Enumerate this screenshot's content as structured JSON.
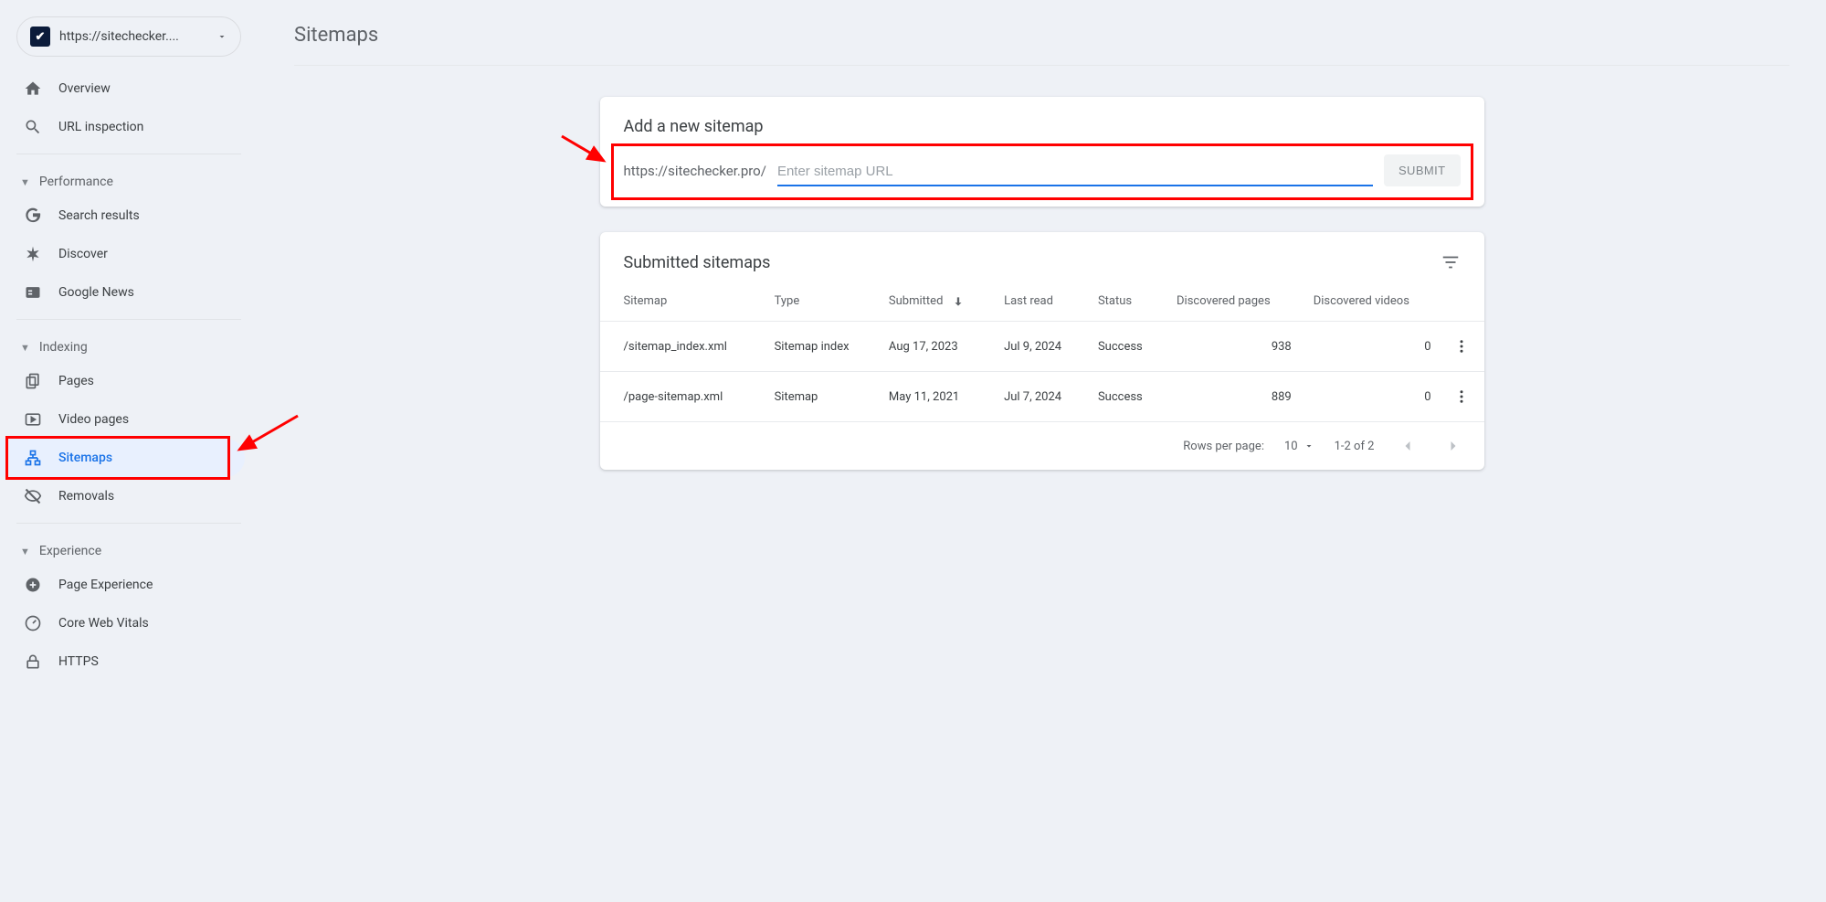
{
  "property_selector": {
    "label": "https://sitechecker....",
    "favicon_letter": "✔"
  },
  "sidebar": {
    "top": [
      {
        "icon": "home",
        "label": "Overview"
      },
      {
        "icon": "search",
        "label": "URL inspection"
      }
    ],
    "sections": [
      {
        "title": "Performance",
        "items": [
          {
            "icon": "g",
            "label": "Search results"
          },
          {
            "icon": "asterisk",
            "label": "Discover"
          },
          {
            "icon": "news",
            "label": "Google News"
          }
        ]
      },
      {
        "title": "Indexing",
        "items": [
          {
            "icon": "pages",
            "label": "Pages"
          },
          {
            "icon": "video",
            "label": "Video pages"
          },
          {
            "icon": "sitemap",
            "label": "Sitemaps",
            "active": true
          },
          {
            "icon": "removals",
            "label": "Removals"
          }
        ]
      },
      {
        "title": "Experience",
        "items": [
          {
            "icon": "pageexp",
            "label": "Page Experience"
          },
          {
            "icon": "cwv",
            "label": "Core Web Vitals"
          },
          {
            "icon": "https",
            "label": "HTTPS"
          }
        ]
      }
    ]
  },
  "page": {
    "title": "Sitemaps"
  },
  "add_card": {
    "title": "Add a new sitemap",
    "url_prefix": "https://sitechecker.pro/",
    "placeholder": "Enter sitemap URL",
    "submit": "SUBMIT"
  },
  "table_card": {
    "title": "Submitted sitemaps",
    "headers": {
      "sitemap": "Sitemap",
      "type": "Type",
      "submitted": "Submitted",
      "last_read": "Last read",
      "status": "Status",
      "discovered_pages": "Discovered pages",
      "discovered_videos": "Discovered videos"
    },
    "rows": [
      {
        "sitemap": "/sitemap_index.xml",
        "type": "Sitemap index",
        "submitted": "Aug 17, 2023",
        "last_read": "Jul 9, 2024",
        "status": "Success",
        "discovered_pages": "938",
        "discovered_videos": "0"
      },
      {
        "sitemap": "/page-sitemap.xml",
        "type": "Sitemap",
        "submitted": "May 11, 2021",
        "last_read": "Jul 7, 2024",
        "status": "Success",
        "discovered_pages": "889",
        "discovered_videos": "0"
      }
    ],
    "pager": {
      "rows_per_page_label": "Rows per page:",
      "rows_per_page_value": "10",
      "range": "1-2 of 2"
    }
  }
}
